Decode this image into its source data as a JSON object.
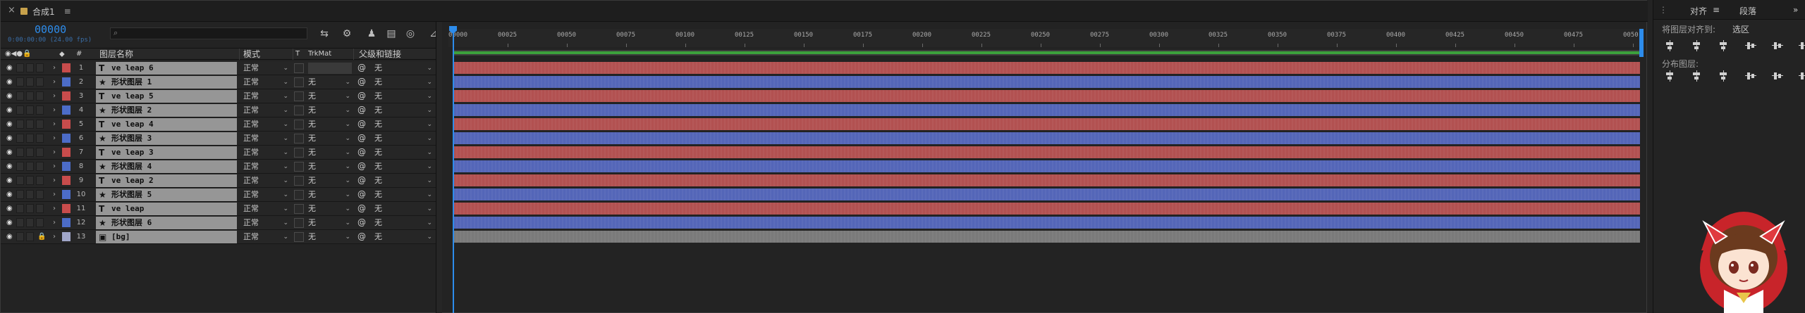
{
  "tab": {
    "close": "×",
    "title": "合成1",
    "menu": "≡"
  },
  "timecode": {
    "value": "00000",
    "sub": "0:00:00:00 (24.00 fps)"
  },
  "search": {
    "icon": "search-icon",
    "placeholder": ""
  },
  "toolbar": [
    "comp-flowchart-icon",
    "draft-3d-icon",
    "shy-layers-icon",
    "frame-blending-icon",
    "motion-blur-icon",
    "graph-editor-icon"
  ],
  "columns": {
    "name": "图层名称",
    "mode": "模式",
    "t": "T",
    "trkmat": "TrkMat",
    "parent": "父级和链接",
    "label": "#"
  },
  "layers": [
    {
      "num": "1",
      "type": "T",
      "name": "ve leap 6",
      "mode": "正常",
      "trk": "",
      "parent": "无",
      "color": "#c84c4c",
      "bar": "#b25151"
    },
    {
      "num": "2",
      "type": "★",
      "name": "形状图层 1",
      "mode": "正常",
      "trk": "无",
      "parent": "无",
      "color": "#4c6cc8",
      "bar": "#5466b8"
    },
    {
      "num": "3",
      "type": "T",
      "name": "ve leap 5",
      "mode": "正常",
      "trk": "无",
      "parent": "无",
      "color": "#c84c4c",
      "bar": "#b25151"
    },
    {
      "num": "4",
      "type": "★",
      "name": "形状图层 2",
      "mode": "正常",
      "trk": "无",
      "parent": "无",
      "color": "#4c6cc8",
      "bar": "#5466b8"
    },
    {
      "num": "5",
      "type": "T",
      "name": "ve leap 4",
      "mode": "正常",
      "trk": "无",
      "parent": "无",
      "color": "#c84c4c",
      "bar": "#b25151"
    },
    {
      "num": "6",
      "type": "★",
      "name": "形状图层 3",
      "mode": "正常",
      "trk": "无",
      "parent": "无",
      "color": "#4c6cc8",
      "bar": "#5466b8"
    },
    {
      "num": "7",
      "type": "T",
      "name": "ve leap 3",
      "mode": "正常",
      "trk": "无",
      "parent": "无",
      "color": "#c84c4c",
      "bar": "#b25151"
    },
    {
      "num": "8",
      "type": "★",
      "name": "形状图层 4",
      "mode": "正常",
      "trk": "无",
      "parent": "无",
      "color": "#4c6cc8",
      "bar": "#5466b8"
    },
    {
      "num": "9",
      "type": "T",
      "name": "ve leap 2",
      "mode": "正常",
      "trk": "无",
      "parent": "无",
      "color": "#c84c4c",
      "bar": "#b25151"
    },
    {
      "num": "10",
      "type": "★",
      "name": "形状图层 5",
      "mode": "正常",
      "trk": "无",
      "parent": "无",
      "color": "#4c6cc8",
      "bar": "#5466b8"
    },
    {
      "num": "11",
      "type": "T",
      "name": "ve leap",
      "mode": "正常",
      "trk": "无",
      "parent": "无",
      "color": "#c84c4c",
      "bar": "#b25151"
    },
    {
      "num": "12",
      "type": "★",
      "name": "形状图层 6",
      "mode": "正常",
      "trk": "无",
      "parent": "无",
      "color": "#4c6cc8",
      "bar": "#5466b8"
    },
    {
      "num": "13",
      "type": "▣",
      "name": "[bg]",
      "mode": "正常",
      "trk": "无",
      "parent": "无",
      "color": "#a0a6c8",
      "bar": "#7a7a7a"
    }
  ],
  "ruler": [
    "00025",
    "00050",
    "00075",
    "00100",
    "00125",
    "00150",
    "00175",
    "00200",
    "00225",
    "00250",
    "00275",
    "00300",
    "00325",
    "00350",
    "00375",
    "00400",
    "00425",
    "00450",
    "00475",
    "0050"
  ],
  "ruler_start": "00000",
  "panel": {
    "tab1": "对齐",
    "tab1_menu": "≡",
    "tab2": "段落",
    "more": "»",
    "align_label": "将图层对齐到:",
    "align_value": "选区",
    "distribute_label": "分布图层:"
  },
  "colors": {
    "accent": "#2d8ceb",
    "workarea": "#3ca13c"
  }
}
